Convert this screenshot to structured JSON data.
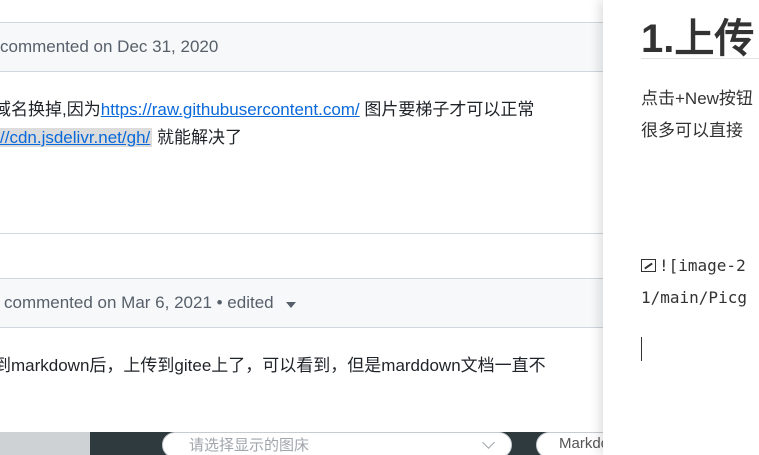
{
  "comments": [
    {
      "header": "commented on Dec 31, 2020",
      "line1_prefix": "域名换掉,因为",
      "line1_link": "https://raw.githubusercontent.com/",
      "line1_suffix": " 图片要梯子才可以正常",
      "line2_code": "//cdn.jsdelivr.net/gh/",
      "line2_suffix": " 就能解决了"
    },
    {
      "header": "commented on Mar 6, 2021 • edited",
      "line1": "到markdown后，上传到gitee上了，可以看到，但是marddown文档一直不"
    }
  ],
  "bottom": {
    "select_placeholder": "请选择显示的图床",
    "format_label": "Markdown"
  },
  "editor": {
    "heading": "1.上传",
    "para_line1": "点击+New按钮",
    "para_line2": "很多可以直接",
    "image_line1": "![image-2",
    "image_line2": "1/main/Picg"
  }
}
